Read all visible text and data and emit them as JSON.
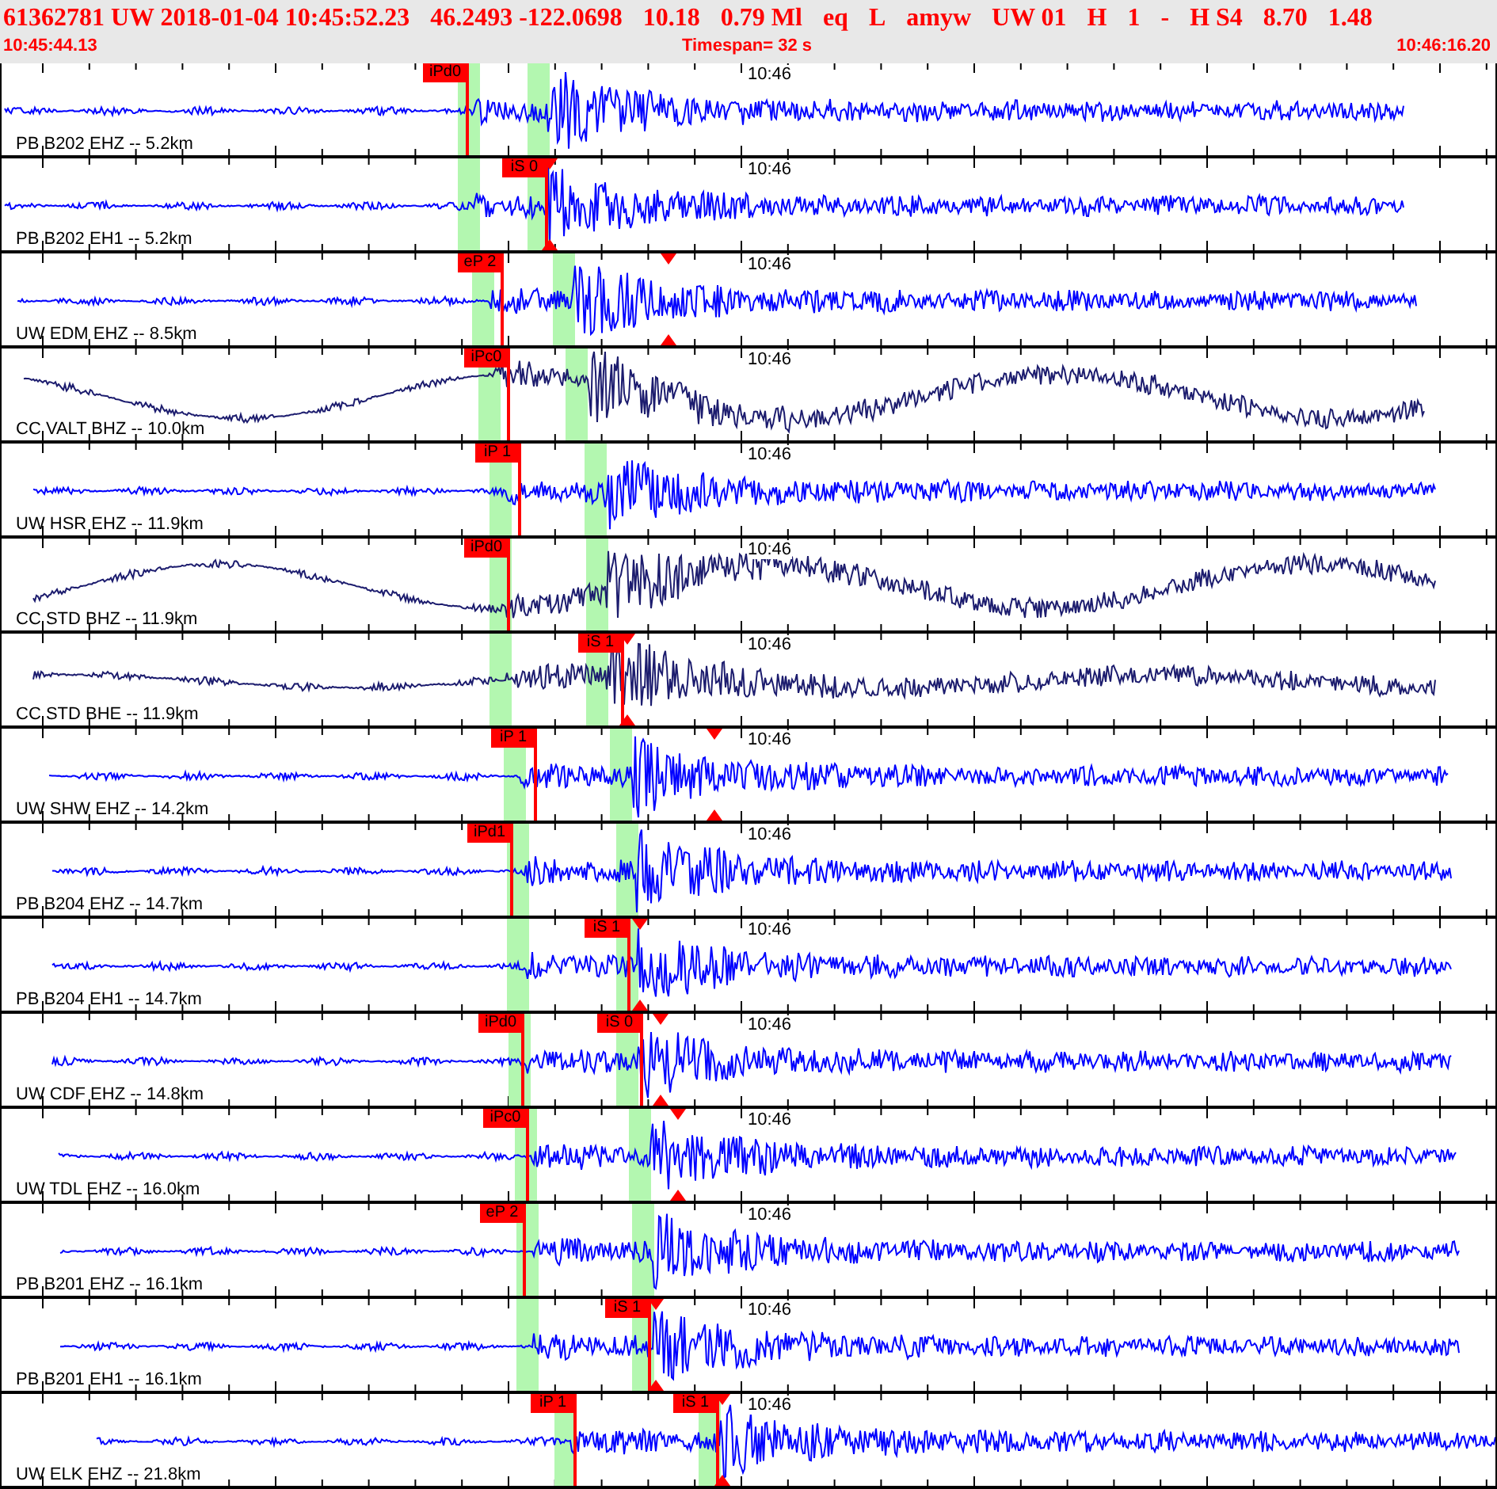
{
  "header": {
    "fields": [
      "61362781 UW 2018-01-04 10:45:52.23",
      "46.2493 -122.0698",
      "10.18",
      "0.79 Ml",
      "eq",
      "L",
      "amyw",
      "UW 01",
      "H",
      "1",
      "-",
      "H S4",
      "8.70",
      "1.48"
    ],
    "start": "10:45:44.13",
    "timespan": "Timespan=  32 s",
    "end": "10:46:16.20"
  },
  "traces": [
    {
      "label": "PB B202 EHZ -- 5.2km",
      "time_mark": "10:46",
      "color": "#0000ff",
      "picks": [
        "iPd0"
      ]
    },
    {
      "label": "PB B202 EH1 -- 5.2km",
      "time_mark": "10:46",
      "color": "#0000ff",
      "picks": [
        "iS 0"
      ]
    },
    {
      "label": "UW EDM EHZ -- 8.5km",
      "time_mark": "10:46",
      "color": "#0000ff",
      "picks": [
        "eP 2"
      ]
    },
    {
      "label": "CC VALT BHZ -- 10.0km",
      "time_mark": "10:46",
      "color": "#1c1c6e",
      "picks": [
        "iPc0"
      ]
    },
    {
      "label": "UW HSR EHZ -- 11.9km",
      "time_mark": "10:46",
      "color": "#0000ff",
      "picks": [
        "iP 1"
      ]
    },
    {
      "label": "CC STD BHZ -- 11.9km",
      "time_mark": "10:46",
      "color": "#1c1c6e",
      "picks": [
        "iPd0"
      ]
    },
    {
      "label": "CC STD BHE -- 11.9km",
      "time_mark": "10:46",
      "color": "#1c1c6e",
      "picks": [
        "iS 1"
      ]
    },
    {
      "label": "UW SHW EHZ -- 14.2km",
      "time_mark": "10:46",
      "color": "#0000ff",
      "picks": [
        "iP 1"
      ]
    },
    {
      "label": "PB B204 EHZ -- 14.7km",
      "time_mark": "10:46",
      "color": "#0000ff",
      "picks": [
        "iPd1"
      ]
    },
    {
      "label": "PB B204 EH1 -- 14.7km",
      "time_mark": "10:46",
      "color": "#0000ff",
      "picks": [
        "iS 1"
      ]
    },
    {
      "label": "UW CDF EHZ -- 14.8km",
      "time_mark": "10:46",
      "color": "#0000ff",
      "picks": [
        "iPd0",
        "iS 0"
      ]
    },
    {
      "label": "UW TDL EHZ -- 16.0km",
      "time_mark": "10:46",
      "color": "#0000ff",
      "picks": [
        "iPc0"
      ]
    },
    {
      "label": "PB B201 EHZ -- 16.1km",
      "time_mark": "10:46",
      "color": "#0000ff",
      "picks": [
        "eP 2"
      ]
    },
    {
      "label": "PB B201 EH1 -- 16.1km",
      "time_mark": "10:46",
      "color": "#0000ff",
      "picks": [
        "iS 1"
      ]
    },
    {
      "label": "UW ELK EHZ -- 21.8km",
      "time_mark": "10:46",
      "color": "#0000ff",
      "picks": [
        "iP 1",
        "iS 1"
      ]
    }
  ]
}
